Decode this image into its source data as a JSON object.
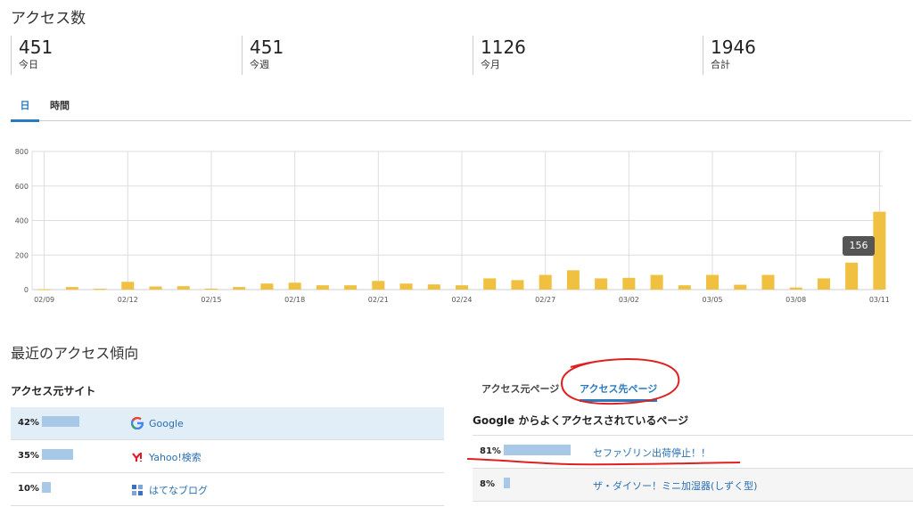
{
  "title": "アクセス数",
  "stats": [
    {
      "value": "451",
      "label": "今日"
    },
    {
      "value": "451",
      "label": "今週"
    },
    {
      "value": "1126",
      "label": "今月"
    },
    {
      "value": "1946",
      "label": "合計"
    }
  ],
  "range_tabs": {
    "day": "日",
    "hour": "時間"
  },
  "tooltip": "156",
  "chart_data": {
    "type": "bar",
    "ylim": [
      0,
      800
    ],
    "yticks": [
      0,
      200,
      400,
      600,
      800
    ],
    "xticks": [
      "02/09",
      "02/12",
      "02/15",
      "02/18",
      "02/21",
      "02/24",
      "02/27",
      "03/02",
      "03/05",
      "03/08",
      "03/11"
    ],
    "categories": [
      "02/09",
      "02/10",
      "02/11",
      "02/12",
      "02/13",
      "02/14",
      "02/15",
      "02/16",
      "02/17",
      "02/18",
      "02/19",
      "02/20",
      "02/21",
      "02/22",
      "02/23",
      "02/24",
      "02/25",
      "02/26",
      "02/27",
      "02/28",
      "03/01",
      "03/02",
      "03/03",
      "03/04",
      "03/05",
      "03/06",
      "03/07",
      "03/08",
      "03/09",
      "03/10",
      "03/11"
    ],
    "values": [
      2,
      15,
      5,
      45,
      18,
      20,
      6,
      15,
      35,
      40,
      25,
      25,
      50,
      35,
      30,
      25,
      65,
      55,
      85,
      112,
      65,
      68,
      85,
      25,
      85,
      28,
      85,
      12,
      65,
      156,
      451
    ],
    "bar_color": "#f0c040",
    "grid": true
  },
  "recent_title": "最近のアクセス傾向",
  "sources": {
    "title": "アクセス元サイト",
    "items": [
      {
        "pct": "42%",
        "share": 42,
        "name": "Google",
        "icon": "google-icon"
      },
      {
        "pct": "35%",
        "share": 35,
        "name": "Yahoo!検索",
        "icon": "yahoo-icon"
      },
      {
        "pct": "10%",
        "share": 10,
        "name": "はてなブログ",
        "icon": "hatena-icon"
      }
    ]
  },
  "page_tabs": {
    "from": "アクセス元ページ",
    "to": "アクセス先ページ"
  },
  "pages": {
    "title": "Google からよくアクセスされているページ",
    "items": [
      {
        "pct": "81%",
        "share": 81,
        "name": "セファゾリン出荷停止！！"
      },
      {
        "pct": "8%",
        "share": 8,
        "name": "ザ・ダイソー！ミニ加湿器(しずく型)"
      }
    ]
  },
  "colors": {
    "accent": "#2a7ac0",
    "bar": "#f0c040",
    "annotation": "#e02020"
  }
}
